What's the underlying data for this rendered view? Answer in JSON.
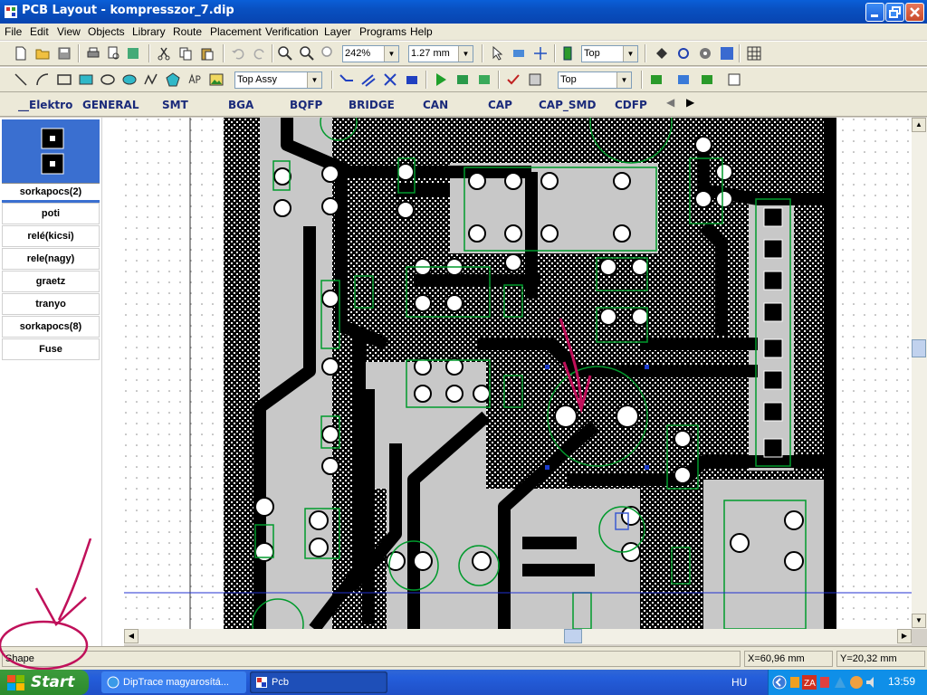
{
  "window": {
    "title": "PCB Layout - kompresszor_7.dip"
  },
  "menu": [
    "File",
    "Edit",
    "View",
    "Objects",
    "Library",
    "Route",
    "Placement",
    "Verification",
    "Layer",
    "Programs",
    "Help"
  ],
  "toolbar1": {
    "zoom": "242%",
    "grid": "1.27 mm",
    "layer": "Top"
  },
  "toolbar2": {
    "view_mode": "Top Assy",
    "side": "Top"
  },
  "libraries": [
    "__Elektro",
    "GENERAL",
    "SMT",
    "BGA",
    "BQFP",
    "BRIDGE",
    "CAN",
    "CAP",
    "CAP_SMD",
    "CDFP"
  ],
  "components": {
    "selected": "sorkapocs(2)",
    "items": [
      "poti",
      "relé(kicsi)",
      "rele(nagy)",
      "graetz",
      "tranyo",
      "sorkapocs(8)",
      "Fuse"
    ]
  },
  "status": {
    "mode": "Shape",
    "x": "X=60,96 mm",
    "y": "Y=20,32 mm"
  },
  "taskbar": {
    "start": "Start",
    "tasks": [
      "DipTrace magyarosítá...",
      "Pcb"
    ],
    "lang": "HU",
    "clock": "13:59"
  },
  "colors": {
    "accent": "#0a5fd8",
    "copper": "#000000",
    "footprint": "#009a2c",
    "annotation": "#c0105a"
  }
}
